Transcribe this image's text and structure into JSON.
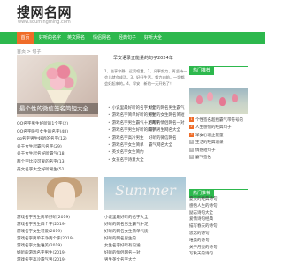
{
  "header": {
    "logo_title": "搜网名网",
    "logo_url": "www.soumingming.com"
  },
  "nav": {
    "items": [
      "首页",
      "好听的名字",
      "英文网名",
      "情侣网名",
      "经典句子",
      "好听大全"
    ]
  },
  "crumb": "首页 > 句子",
  "hero": {
    "caption": "最个性的微信签名简短大全"
  },
  "left_list": [
    "QQ名字男生好听的1个字(2)",
    "QQ名字吸引女生的名字(48)",
    "qq名字男生好听的名字(12)",
    "关于女生起霸气名字(29)",
    "关于女生起名好听霸气(18)",
    "两个字比较可爱的名字(13)",
    "英文名字大全好听男生(51)"
  ],
  "article": {
    "title": "早安语录正能量的句子2024年",
    "body": "1、坐享宁静，远离喧嚣。2、凡事努力，再坚持一会儿就会成功。3、好好生活，努力向前，一切都会好起来的。4、早安，新的一天开始了！"
  },
  "mid_list": [
    "小说里最好听的名字大全",
    "游戏名字简单好听的男生",
    "游戏名字男生霸气十足两字",
    "游戏名字男生好听的四字",
    "游戏名字高冷男生",
    "游戏名字女生简单",
    "英文名字女生简约",
    "女孩名字诗意大全"
  ],
  "mid_list_right": [
    "好听的网名男生霸气",
    "好听的女生网名简短",
    "好听的情侣网名一对",
    "最新男生网名大全",
    "好听的微信网名",
    "霸气网名大全"
  ],
  "side_head_1": "热门推荐",
  "side_list_1": [
    "个性签名超拽霸气带符号的",
    "人生感悟的经典句子",
    "早安心语正能量",
    "生活的经典语录",
    "情感短句子",
    "霸气签名"
  ],
  "side_head_2": "热门推荐",
  "side_list_2": [
    "夏天的经典诗句",
    "感悟人生的诗句",
    "励志诗句大全",
    "爱情诗句经典",
    "描写春天的诗句",
    "思念的诗句",
    "唯美的诗句",
    "关于月亮的诗句",
    "写秋天的诗句"
  ],
  "tile2_word": "Summer",
  "bottom_left": [
    "游戏名字男生简单好听(2019)",
    "游戏名字男生四个字(2019)",
    "游戏名字女生可爱(2019)",
    "游戏名字简单干净两个字(2019)",
    "游戏名字女生唯美(2019)",
    "好听的游戏名字男生(2019)",
    "游戏名字高冷霸气男(2019)"
  ],
  "bottom_mid": [
    "小说里最好听的名字大全",
    "好听的网名男生霸气十足",
    "好听的网名女生简单气质",
    "好听的网名男生的",
    "女生名字好听有内涵",
    "好听的情侣网名一对",
    "男生英文名字大全"
  ],
  "colors": {
    "nav_green": "#2db84d",
    "nav_active_orange": "#ef6c28"
  }
}
